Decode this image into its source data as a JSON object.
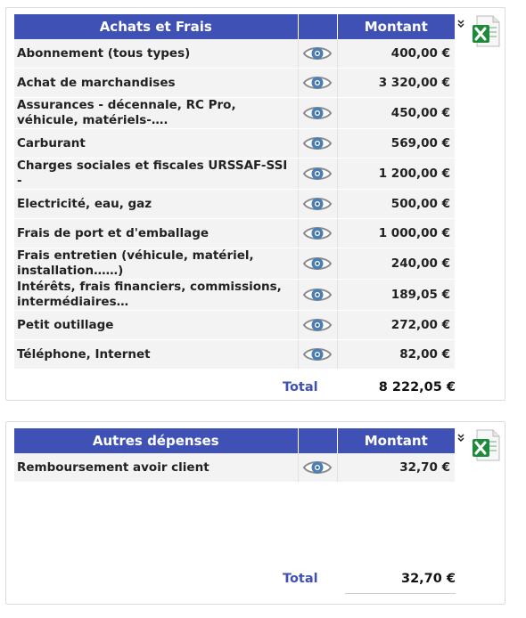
{
  "panels": [
    {
      "header": {
        "category": "Achats et Frais",
        "amount": "Montant"
      },
      "rows": [
        {
          "label": "Abonnement (tous types)",
          "amount": "400,00 €"
        },
        {
          "label": "Achat de marchandises",
          "amount": "3 320,00 €"
        },
        {
          "label": "Assurances - décennale, RC Pro, véhicule, matériels-….",
          "amount": "450,00 €"
        },
        {
          "label": "Carburant",
          "amount": "569,00 €"
        },
        {
          "label": "Charges sociales et fiscales URSSAF-SSI -",
          "amount": "1 200,00 €"
        },
        {
          "label": "Electricité, eau, gaz",
          "amount": "500,00 €"
        },
        {
          "label": "Frais de port et d'emballage",
          "amount": "1 000,00 €"
        },
        {
          "label": "Frais entretien (véhicule, matériel, installation……)",
          "amount": "240,00 €"
        },
        {
          "label": "Intérêts, frais financiers, commissions, intermédiaires…",
          "amount": "189,05 €"
        },
        {
          "label": "Petit outillage",
          "amount": "272,00 €"
        },
        {
          "label": "Téléphone, Internet",
          "amount": "82,00 €"
        }
      ],
      "total_label": "Total",
      "total_value": "8 222,05 €"
    },
    {
      "header": {
        "category": "Autres dépenses",
        "amount": "Montant"
      },
      "rows": [
        {
          "label": "Remboursement avoir client",
          "amount": "32,70 €"
        }
      ],
      "total_label": "Total",
      "total_value": "32,70 €"
    }
  ],
  "icons": {
    "view": "eye-icon",
    "export": "excel-export-icon",
    "collapse": "double-chevron-down-icon"
  },
  "colors": {
    "header_bg": "#3f51b5",
    "header_text": "#ffffff",
    "row_bg": "#f3f3f3",
    "total_label": "#3f51b5",
    "eye": "#4a7fb5",
    "excel_green": "#1e8a3c"
  }
}
